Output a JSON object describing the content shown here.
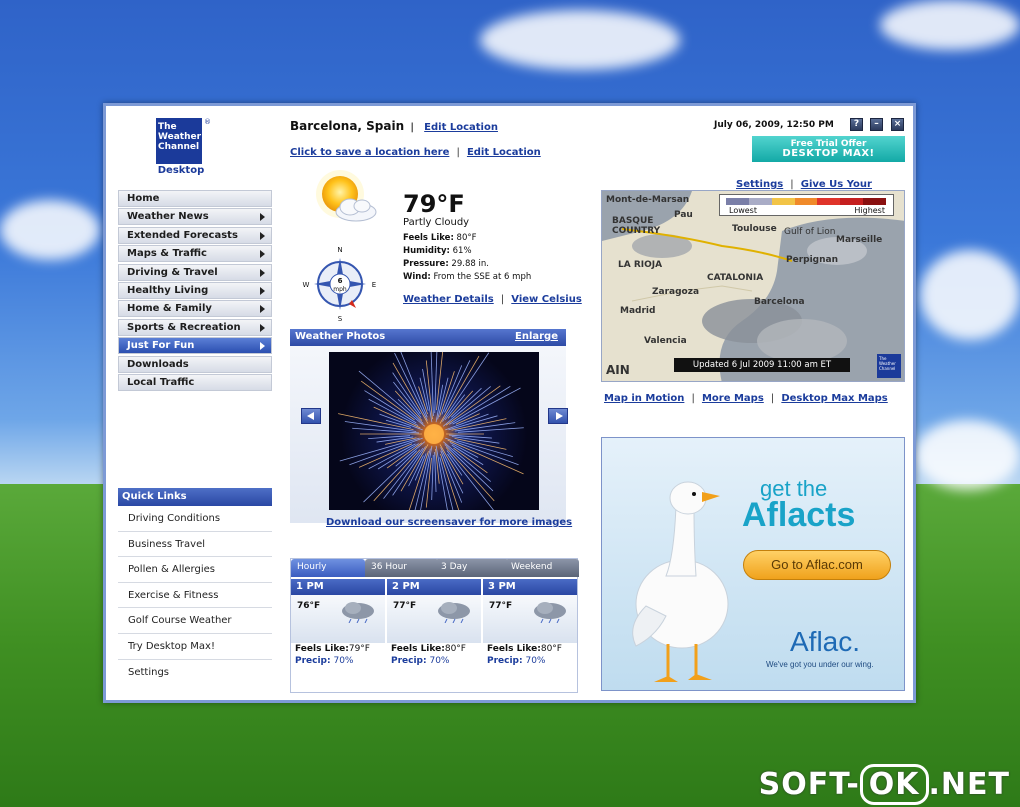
{
  "header": {
    "logo_lines": [
      "The",
      "Weather",
      "Channel"
    ],
    "logo_reg": "®",
    "logo_sub": "Desktop",
    "location": "Barcelona, Spain",
    "edit_location": "Edit Location",
    "save_location": "Click to save a location here",
    "edit_location2": "Edit Location",
    "separator": "|",
    "datetime": "July 06, 2009, 12:50 PM",
    "help_btn": "?",
    "minimize_btn": "–",
    "close_btn": "×",
    "promo_line1": "Free Trial Offer",
    "promo_line2": "DESKTOP MAX!",
    "settings": "Settings",
    "feedback": "Give Us Your Feedback"
  },
  "nav": {
    "items": [
      {
        "label": "Home",
        "arrow": false,
        "active": false
      },
      {
        "label": "Weather News",
        "arrow": true,
        "active": false
      },
      {
        "label": "Extended Forecasts",
        "arrow": true,
        "active": false
      },
      {
        "label": "Maps & Traffic",
        "arrow": true,
        "active": false
      },
      {
        "label": "Driving & Travel",
        "arrow": true,
        "active": false
      },
      {
        "label": "Healthy Living",
        "arrow": true,
        "active": false
      },
      {
        "label": "Home & Family",
        "arrow": true,
        "active": false
      },
      {
        "label": "Sports & Recreation",
        "arrow": true,
        "active": false
      },
      {
        "label": "Just For Fun",
        "arrow": true,
        "active": true
      },
      {
        "label": "Downloads",
        "arrow": false,
        "active": false
      },
      {
        "label": "Local Traffic",
        "arrow": false,
        "active": false
      }
    ]
  },
  "quick_links": {
    "title": "Quick Links",
    "items": [
      "Driving Conditions",
      "Business Travel",
      "Pollen & Allergies",
      "Exercise & Fitness",
      "Golf Course Weather",
      "Try Desktop Max!",
      "Settings"
    ]
  },
  "current": {
    "temp": "79°F",
    "condition": "Partly Cloudy",
    "feels_like_label": "Feels Like:",
    "feels_like": "80°F",
    "humidity_label": "Humidity:",
    "humidity": "61%",
    "pressure_label": "Pressure:",
    "pressure": "29.88 in.",
    "wind_label": "Wind:",
    "wind": "From the SSE at 6 mph",
    "details_link": "Weather Details",
    "celsius_link": "View Celsius",
    "compass": {
      "n": "N",
      "s": "S",
      "e": "E",
      "w": "W",
      "speed": "6",
      "unit": "mph"
    }
  },
  "map": {
    "legend_low": "Lowest",
    "legend_high": "Highest",
    "legend_colors": [
      "#7a7fa8",
      "#a9acc6",
      "#f2c447",
      "#f08a2a",
      "#e0342a",
      "#c51f1f",
      "#8a1010"
    ],
    "updated": "Updated 6 Jul 2009 11:00 am ET",
    "labels": [
      "Mont-de-Marsan",
      "Pau",
      "Toulouse",
      "Gulf of Lion",
      "Marseille",
      "BASQUE COUNTRY",
      "LA RIOJA",
      "Perpignan",
      "Zaragoza",
      "CATALONIA",
      "Barcelona",
      "Madrid",
      "Valencia",
      "AIN"
    ],
    "logo_text": "The Weather Channel",
    "links": [
      "Map in Motion",
      "More Maps",
      "Desktop Max Maps"
    ]
  },
  "photos": {
    "title": "Weather Photos",
    "enlarge": "Enlarge",
    "download": "Download our screensaver for more images"
  },
  "forecast": {
    "tabs": [
      "Hourly",
      "36 Hour",
      "3 Day",
      "Weekend"
    ],
    "hours": [
      {
        "time": "1 PM",
        "temp": "76°F",
        "feels_label": "Feels Like:",
        "feels": "79°F",
        "precip_label": "Precip:",
        "precip": "70%"
      },
      {
        "time": "2 PM",
        "temp": "77°F",
        "feels_label": "Feels Like:",
        "feels": "80°F",
        "precip_label": "Precip:",
        "precip": "70%"
      },
      {
        "time": "3 PM",
        "temp": "77°F",
        "feels_label": "Feels Like:",
        "feels": "80°F",
        "precip_label": "Precip:",
        "precip": "70%"
      }
    ]
  },
  "ad": {
    "line1": "get the",
    "line2": "Aflacts",
    "button": "Go to Aflac.com",
    "brand": "Aflac.",
    "tagline": "We've got you under our wing."
  },
  "watermark": {
    "left": "SOFT-",
    "mid": "OK",
    "right": ".NET"
  }
}
